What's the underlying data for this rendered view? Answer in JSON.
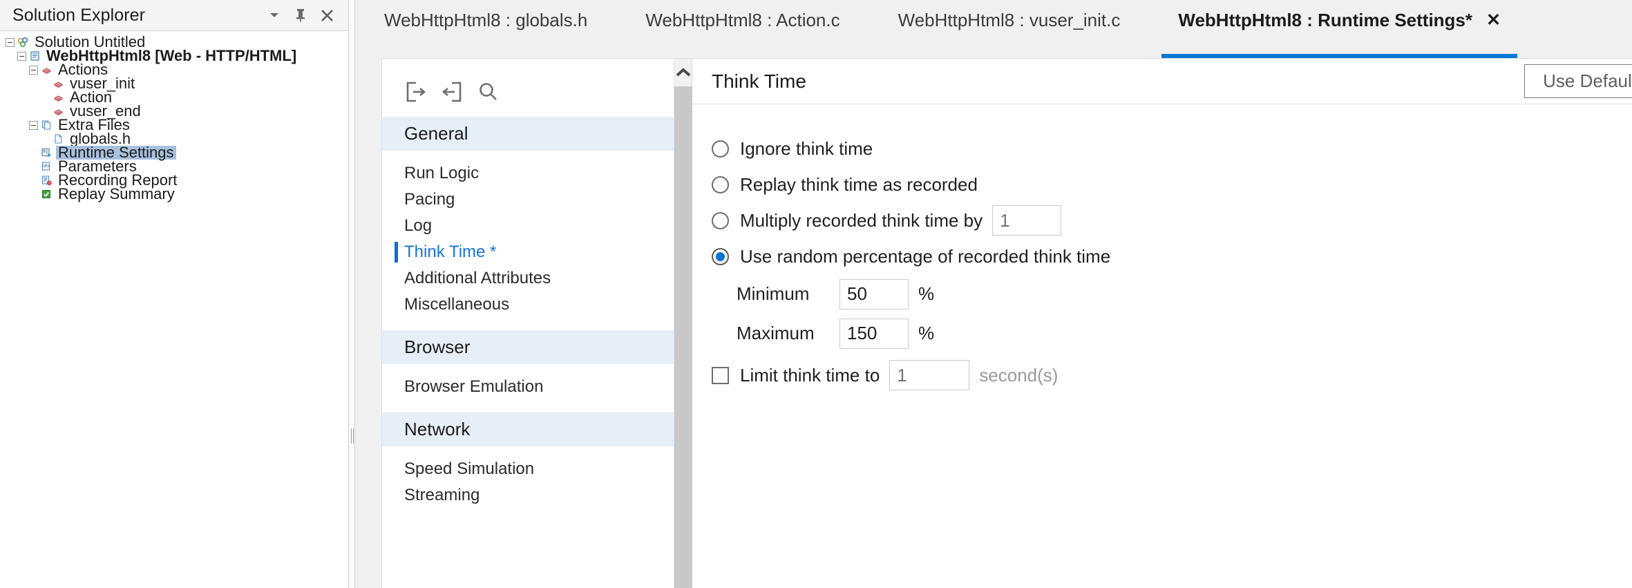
{
  "explorer": {
    "title": "Solution Explorer",
    "header_icons": [
      {
        "name": "chevron-down-icon"
      },
      {
        "name": "pin-icon"
      },
      {
        "name": "close-icon"
      }
    ],
    "tree": [
      {
        "label": "Solution Untitled",
        "depth": 0,
        "expander": "minus",
        "icon": "solution-icon",
        "bold": false,
        "selected": false
      },
      {
        "label": "WebHttpHtml8 [Web - HTTP/HTML]",
        "depth": 1,
        "expander": "minus",
        "icon": "script-icon",
        "bold": true,
        "selected": false
      },
      {
        "label": "Actions",
        "depth": 2,
        "expander": "minus",
        "icon": "actions-icon",
        "bold": false,
        "selected": false
      },
      {
        "label": "vuser_init",
        "depth": 3,
        "expander": "none",
        "icon": "action-block-icon",
        "bold": false,
        "selected": false
      },
      {
        "label": "Action",
        "depth": 3,
        "expander": "none",
        "icon": "action-block-icon",
        "bold": false,
        "selected": false
      },
      {
        "label": "vuser_end",
        "depth": 3,
        "expander": "none",
        "icon": "action-block-icon",
        "bold": false,
        "selected": false
      },
      {
        "label": "Extra Files",
        "depth": 2,
        "expander": "minus",
        "icon": "extra-files-icon",
        "bold": false,
        "selected": false
      },
      {
        "label": "globals.h",
        "depth": 3,
        "expander": "none",
        "icon": "file-icon",
        "bold": false,
        "selected": false
      },
      {
        "label": "Runtime Settings",
        "depth": 2,
        "expander": "none",
        "icon": "runtime-settings-icon",
        "bold": false,
        "selected": true
      },
      {
        "label": "Parameters",
        "depth": 2,
        "expander": "none",
        "icon": "parameters-icon",
        "bold": false,
        "selected": false
      },
      {
        "label": "Recording Report",
        "depth": 2,
        "expander": "none",
        "icon": "recording-report-icon",
        "bold": false,
        "selected": false
      },
      {
        "label": "Replay Summary",
        "depth": 2,
        "expander": "none",
        "icon": "replay-summary-icon",
        "bold": false,
        "selected": false
      }
    ]
  },
  "tabs": [
    {
      "label": "WebHttpHtml8 : globals.h",
      "active": false,
      "closable": false
    },
    {
      "label": "WebHttpHtml8 : Action.c",
      "active": false,
      "closable": false
    },
    {
      "label": "WebHttpHtml8 : vuser_init.c",
      "active": false,
      "closable": false
    },
    {
      "label": "WebHttpHtml8 : Runtime Settings*",
      "active": true,
      "closable": true
    }
  ],
  "tab_close_glyph": "✕",
  "settings_nav": {
    "tools": [
      {
        "name": "export-icon"
      },
      {
        "name": "import-icon"
      },
      {
        "name": "search-icon"
      }
    ],
    "sections": [
      {
        "type": "group",
        "label": "General"
      },
      {
        "type": "item",
        "label": "Run Logic",
        "active": false
      },
      {
        "type": "item",
        "label": "Pacing",
        "active": false
      },
      {
        "type": "item",
        "label": "Log",
        "active": false
      },
      {
        "type": "item",
        "label": "Think Time *",
        "active": true
      },
      {
        "type": "item",
        "label": "Additional Attributes",
        "active": false
      },
      {
        "type": "item",
        "label": "Miscellaneous",
        "active": false
      },
      {
        "type": "group",
        "label": "Browser"
      },
      {
        "type": "item",
        "label": "Browser Emulation",
        "active": false
      },
      {
        "type": "group",
        "label": "Network"
      },
      {
        "type": "item",
        "label": "Speed Simulation",
        "active": false
      },
      {
        "type": "item",
        "label": "Streaming",
        "active": false
      }
    ]
  },
  "pane": {
    "title": "Think Time",
    "use_defaults_label": "Use Defaults",
    "options": [
      {
        "label": "Ignore think time",
        "selected": false
      },
      {
        "label": "Replay think time as recorded",
        "selected": false
      },
      {
        "label": "Multiply recorded think time by",
        "selected": false
      },
      {
        "label": "Use random percentage of recorded think time",
        "selected": true
      }
    ],
    "multiply_value": "",
    "multiply_placeholder": "1",
    "minimum_label": "Minimum",
    "minimum_value": "50",
    "maximum_label": "Maximum",
    "maximum_value": "150",
    "percent_unit": "%",
    "limit_label": "Limit think time to",
    "limit_checked": false,
    "limit_value": "",
    "limit_placeholder": "1",
    "limit_unit": "second(s)"
  },
  "colors": {
    "accent": "#0078d4",
    "nav_active": "#1673d6",
    "group_bg": "#e6eef7",
    "tree_selection": "#a8c0dc",
    "chrome_bg": "#f0f0f0"
  }
}
